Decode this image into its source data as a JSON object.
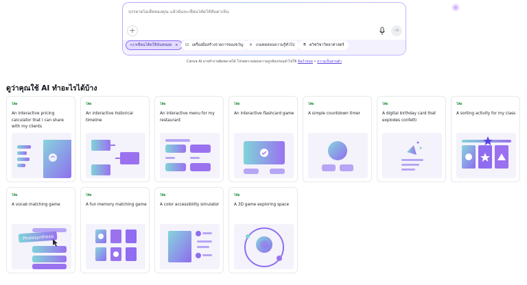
{
  "prompt": {
    "placeholder": "บรรยายไอเดียของคุณ แล้วฉันจะเขียนโค้ดให้ทันตาเห็น",
    "chips": [
      {
        "icon": "code-icon",
        "glyph": "</>",
        "label": "เขียนโค้ดให้ฉันหน่อย",
        "active": true,
        "close": "×"
      },
      {
        "icon": "task-list-icon",
        "glyph": "☑",
        "label": "เครื่องมือสร้างรายการของขวัญ",
        "active": false
      },
      {
        "icon": "trophy-icon",
        "glyph": "♕",
        "label": "เกมทดสอบความรู้ทั่วไป",
        "active": false
      },
      {
        "icon": "science-icon",
        "glyph": "⚗",
        "label": "ควิซวิชาวิทยาศาสตร์",
        "active": false
      }
    ]
  },
  "disclaimer": {
    "text": "Canva AI อาจทำงานผิดพลาดได้ โปรดตรวจสอบความถูกต้องก่อนนำไปใช้ ",
    "link1": "ข้อกำหนด",
    "sep": " • ",
    "link2": "ความเป็นส่วนตัว"
  },
  "section_title": "ดูว่าคุณใช้ AI ทำอะไรได้บ้าง",
  "colors": {
    "accent": "#8b6cf6",
    "badge": "#1f8f3a"
  },
  "cards": [
    {
      "badge": "โค้ด",
      "title": "An interactive pricing calculator that I can share with my clients"
    },
    {
      "badge": "โค้ด",
      "title": "An interactive historical timeline"
    },
    {
      "badge": "โค้ด",
      "title": "An interactive menu for my restaurant"
    },
    {
      "badge": "โค้ด",
      "title": "An interactive flashcard game"
    },
    {
      "badge": "โค้ด",
      "title": "A simple countdown timer"
    },
    {
      "badge": "โค้ด",
      "title": "A digital birthday card that explodes confetti"
    },
    {
      "badge": "โค้ด",
      "title": "A sorting activity for my class"
    },
    {
      "badge": "โค้ด",
      "title": "A vocab matching game",
      "thumb_text": "Photosynthesis"
    },
    {
      "badge": "โค้ด",
      "title": "A fun memory matching game"
    },
    {
      "badge": "โค้ด",
      "title": "A color accessibility simulator"
    },
    {
      "badge": "โค้ด",
      "title": "A 3D game exploring space"
    }
  ]
}
